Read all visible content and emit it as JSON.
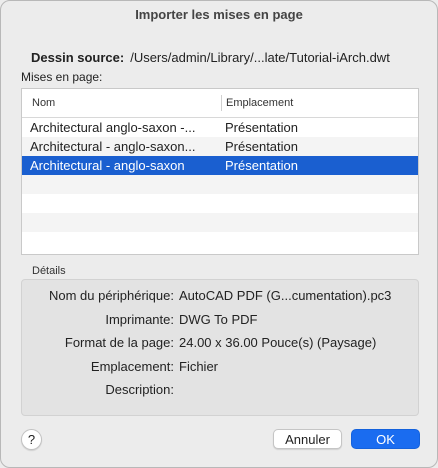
{
  "window": {
    "title": "Importer les mises en page"
  },
  "source": {
    "label": "Dessin source:",
    "path": "/Users/admin/Library/...late/Tutorial-iArch.dwt"
  },
  "layouts": {
    "label": "Mises en page:",
    "columns": [
      "Nom",
      "Emplacement"
    ],
    "rows": [
      {
        "name": "Architectural anglo-saxon -...",
        "location": "Présentation",
        "selected": false
      },
      {
        "name": "Architectural - anglo-saxon...",
        "location": "Présentation",
        "selected": false
      },
      {
        "name": "Architectural - anglo-saxon",
        "location": "Présentation",
        "selected": true
      }
    ]
  },
  "details": {
    "label": "Détails",
    "fields": [
      {
        "key": "Nom du périphérique:",
        "value": "AutoCAD PDF (G...cumentation).pc3"
      },
      {
        "key": "Imprimante:",
        "value": "DWG To PDF"
      },
      {
        "key": "Format de la page:",
        "value": "24.00 x 36.00 Pouce(s) (Paysage)"
      },
      {
        "key": "Emplacement:",
        "value": "Fichier"
      },
      {
        "key": "Description:",
        "value": ""
      }
    ]
  },
  "buttons": {
    "help": "?",
    "cancel": "Annuler",
    "ok": "OK"
  },
  "colors": {
    "selection": "#1a5fd0",
    "ok_button": "#1a6cf0"
  }
}
